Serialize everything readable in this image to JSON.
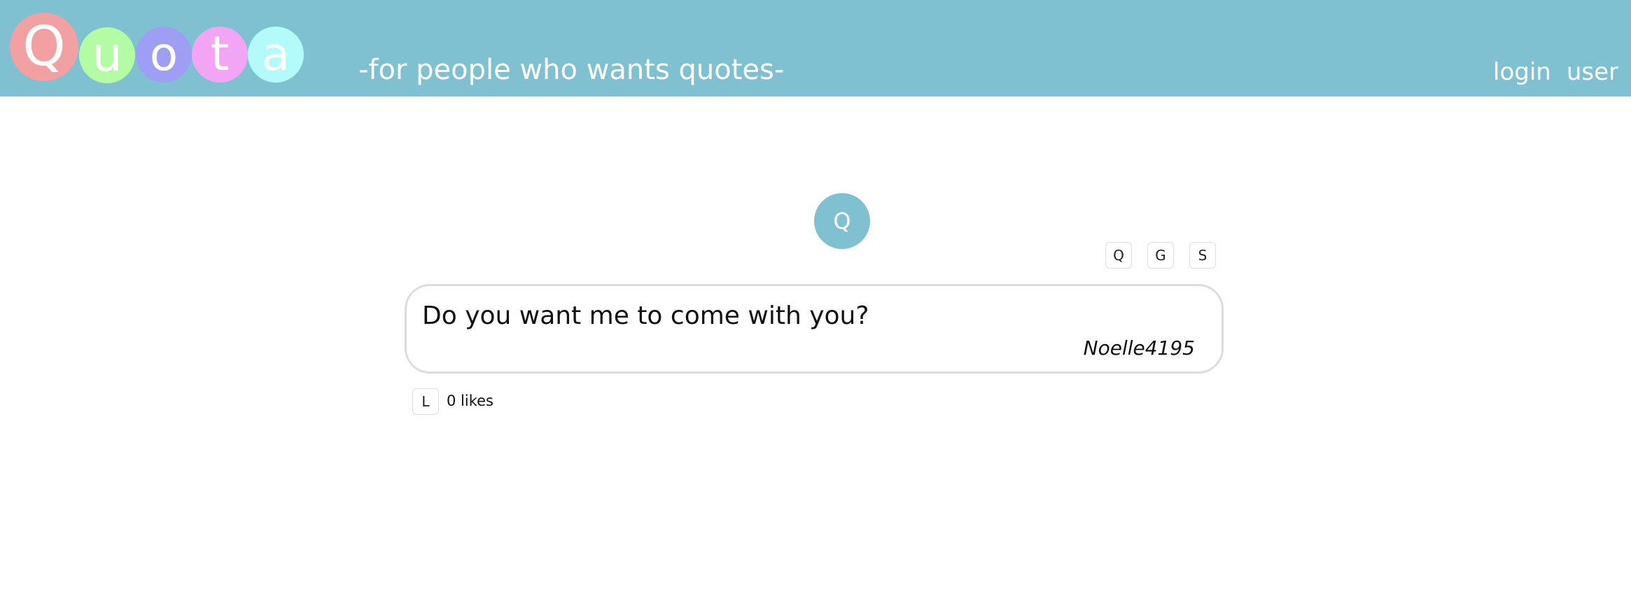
{
  "header": {
    "logo_letters": [
      {
        "char": "Q",
        "color": "#f2a0a1"
      },
      {
        "char": "u",
        "color": "#b4fca4"
      },
      {
        "char": "o",
        "color": "#9e9ef5"
      },
      {
        "char": "t",
        "color": "#f2a5f5"
      },
      {
        "char": "a",
        "color": "#b2fbfa"
      }
    ],
    "tagline": "-for people who wants quotes-",
    "nav": {
      "login": "login",
      "user": "user"
    }
  },
  "quote": {
    "avatar_letter": "Q",
    "actions": {
      "q_label": "Q",
      "g_label": "G",
      "s_label": "S"
    },
    "text": "Do you want me to come with you?",
    "author": "Noelle4195",
    "like_label": "L",
    "likes_text": "0 likes"
  },
  "colors": {
    "header_bg": "#80c1d1",
    "card_border": "#dddddd"
  }
}
